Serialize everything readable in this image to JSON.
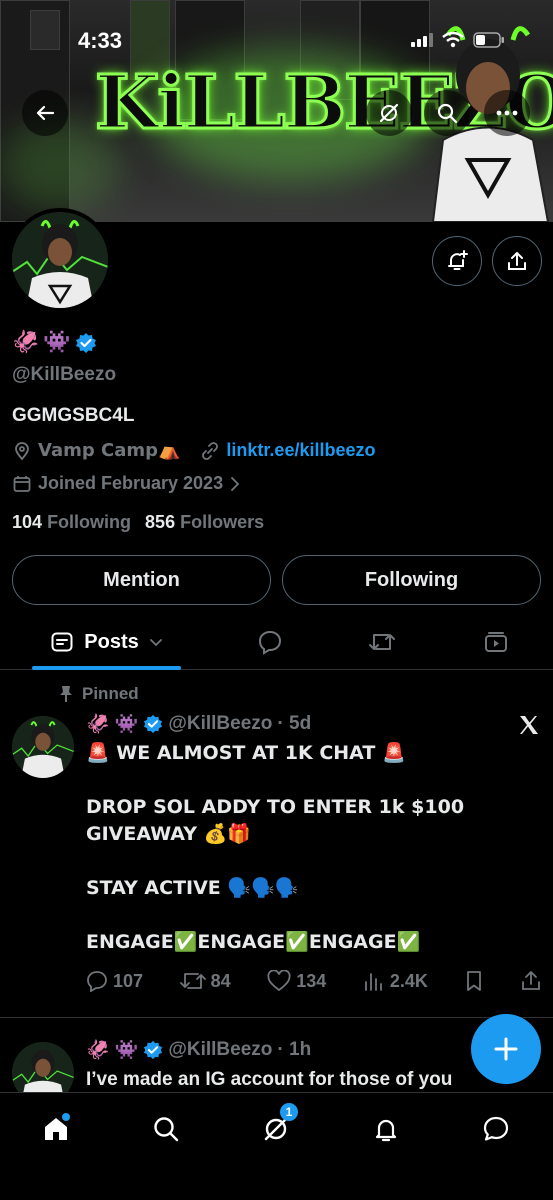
{
  "status": {
    "time": "4:33"
  },
  "banner": {
    "logo_text": "KiLLBEEZO"
  },
  "profile": {
    "emojis": [
      "🦑",
      "👾"
    ],
    "handle": "@KillBeezo",
    "bio": "GGMGSBC4L",
    "location": "Vamp Camp⛺",
    "website": "linktr.ee/killbeezo",
    "joined": "Joined February 2023",
    "following_count": "104",
    "following_label": "Following",
    "followers_count": "856",
    "followers_label": "Followers"
  },
  "buttons": {
    "mention": "Mention",
    "following": "Following"
  },
  "tabs": {
    "posts_label": "Posts"
  },
  "posts": [
    {
      "pinned_label": "Pinned",
      "handle": "@KillBeezo",
      "time": "· 5d",
      "line1": "🚨 WE ALMOST AT 1K CHAT 🚨",
      "line2": "DROP SOL ADDY TO ENTER 1k $100",
      "line3": "GIVEAWAY 💰🎁",
      "line4": "STAY ACTIVE 🗣️🗣️🗣️",
      "line5": "ENGAGE✅ENGAGE✅ENGAGE✅",
      "replies": "107",
      "reposts": "84",
      "likes": "134",
      "views": "2.4K"
    },
    {
      "handle": "@KillBeezo",
      "time": "· 1h",
      "line1": "I’ve made an IG account for those of you"
    }
  ],
  "nav": {
    "messages_badge": "1"
  },
  "colors": {
    "accent": "#1d9bf0",
    "neon": "#8dff52",
    "muted": "#71767b"
  },
  "icons": [
    "back-arrow-icon",
    "grok-icon",
    "search-icon",
    "more-icon",
    "notify-plus-icon",
    "share-icon",
    "location-icon",
    "link-icon",
    "calendar-icon",
    "chevron-right-icon",
    "pin-icon",
    "x-logo-icon",
    "reply-icon",
    "repost-icon",
    "like-icon",
    "views-icon",
    "bookmark-icon",
    "home-icon",
    "bell-icon",
    "chat-icon",
    "plus-icon"
  ]
}
